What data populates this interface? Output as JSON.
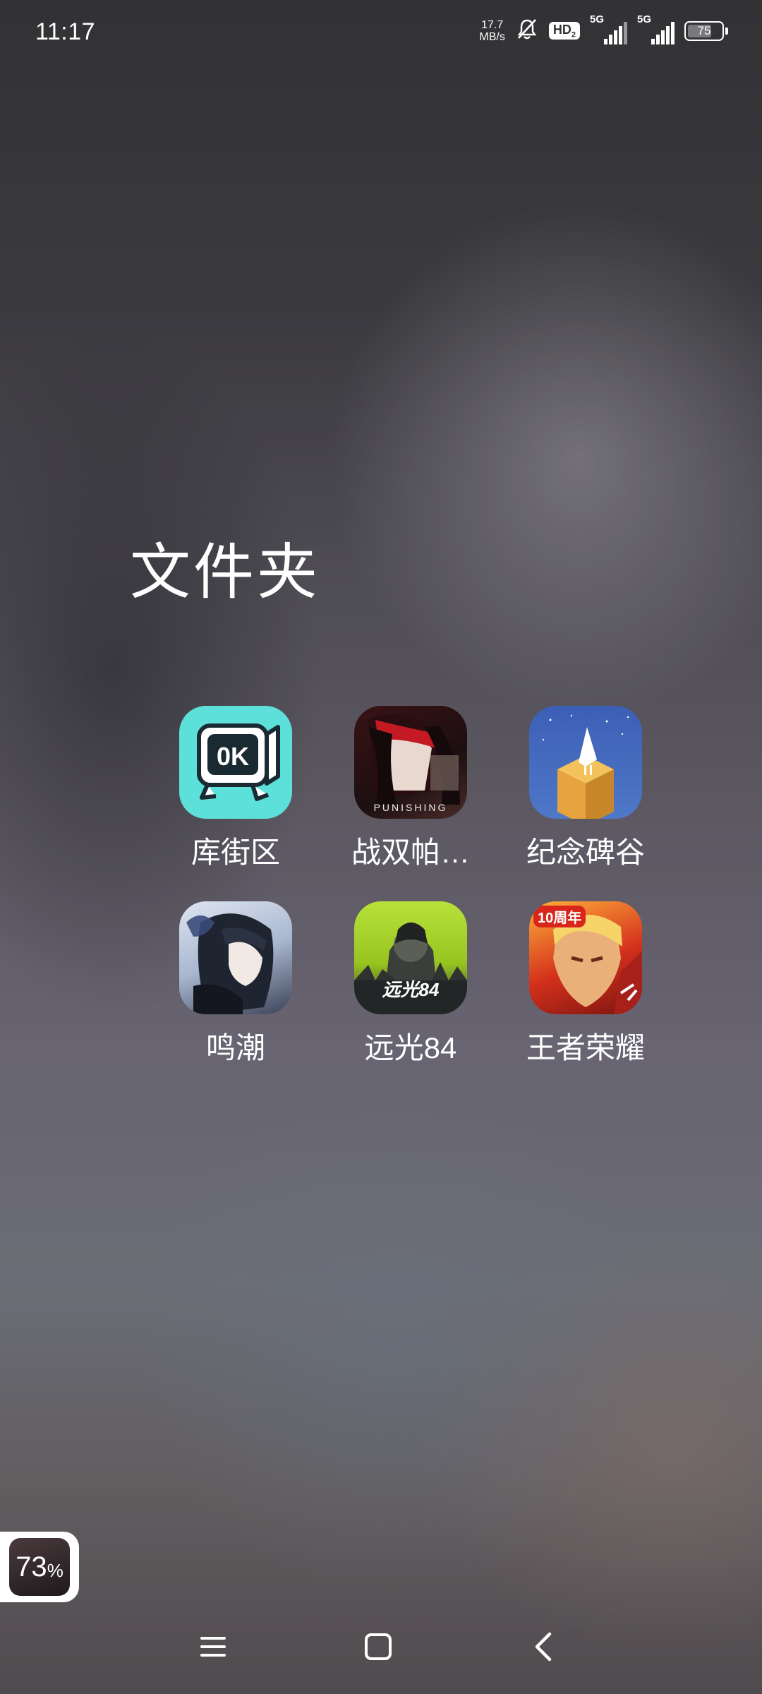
{
  "status_bar": {
    "time": "11:17",
    "net_speed_value": "17.7",
    "net_speed_unit": "MB/s",
    "hd_label": "HD",
    "hd_sub": "2",
    "sim1_label": "5G",
    "sim2_label": "5G",
    "battery_level": "75",
    "icons": [
      "bell-muted-icon",
      "hd-voice-icon",
      "signal-icon",
      "battery-icon"
    ]
  },
  "folder": {
    "title": "文件夹",
    "apps": [
      {
        "label": "库街区",
        "icon": "kujiequ-app-icon"
      },
      {
        "label": "战双帕…",
        "icon": "punishing-app-icon",
        "icon_text": "PUNISHING"
      },
      {
        "label": "纪念碑谷",
        "icon": "monument-valley-app-icon"
      },
      {
        "label": "鸣潮",
        "icon": "wuthering-waves-app-icon"
      },
      {
        "label": "远光84",
        "icon": "yuanguang84-app-icon",
        "icon_text": "远光84"
      },
      {
        "label": "王者荣耀",
        "icon": "honor-of-kings-app-icon",
        "icon_text": "10周年"
      }
    ]
  },
  "floating_widget": {
    "value": "73",
    "unit": "%"
  },
  "nav_bar": {
    "buttons": [
      "menu-icon",
      "home-icon",
      "back-icon"
    ]
  },
  "colors": {
    "kujiequ": "#5ee0da",
    "text": "#ffffff"
  }
}
